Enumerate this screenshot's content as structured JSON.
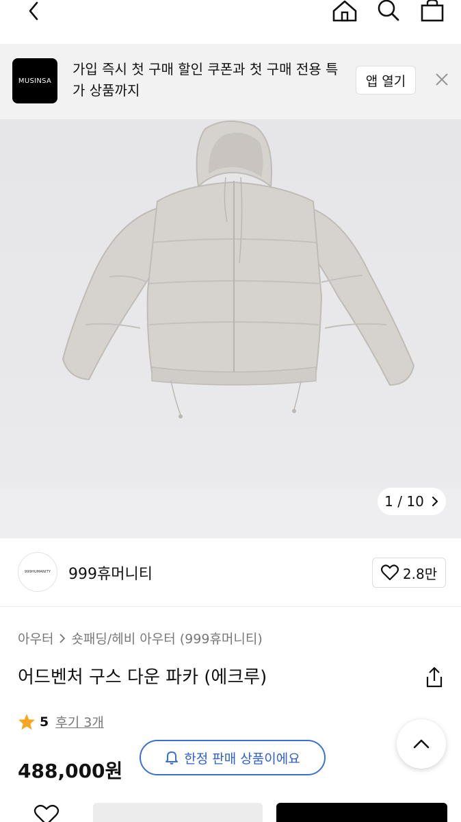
{
  "topnav": {
    "back_icon": "chevron-left-icon",
    "icons": [
      "home-icon",
      "search-icon",
      "shopping-bag-icon"
    ]
  },
  "banner": {
    "logo_text": "MUSINSA",
    "message": "가입 즉시 첫 구매 할인 쿠폰과 첫 구매 전용 특가 상품까지",
    "open_app_label": "앱 열기",
    "close_icon": "close-icon"
  },
  "gallery": {
    "current": "1",
    "separator": "/",
    "total": "10",
    "counter_text": "1 / 10"
  },
  "brand": {
    "logo_text": "999HUMANITY",
    "name": "999휴머니티",
    "like_count": "2.8만"
  },
  "breadcrumb": {
    "items": [
      "아우터",
      "숏패딩/헤비 아우터 (999휴머니티)"
    ]
  },
  "product": {
    "title": "어드벤처 구스 다운 파카 (에크루)",
    "rating": "5",
    "reviews_label": "후기 3개",
    "price": "488,000원",
    "limited_label": "한정 판매 상품이에요"
  },
  "colors": {
    "accent_blue": "#3b6fd6",
    "star": "#f5a623",
    "banner_bg": "#f2f2f2"
  }
}
